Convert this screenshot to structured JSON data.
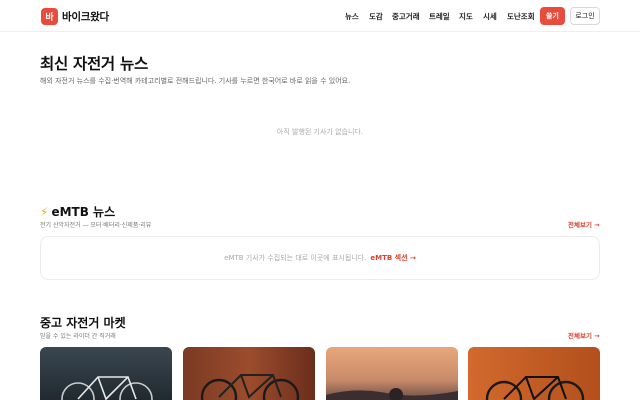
{
  "header": {
    "logo_char": "바",
    "brand": "바이크왔다",
    "nav": [
      "뉴스",
      "도감",
      "중고거래",
      "트레일",
      "지도",
      "시세",
      "도난조회"
    ],
    "write_label": "쓸기",
    "login_label": "로그인"
  },
  "hero": {
    "title": "최신 자전거 뉴스",
    "description": "해외 자전거 뉴스를 수집·번역해 카테고리별로 전해드립니다. 기사를 누르면 한국어로 바로 읽을 수 있어요.",
    "empty": "아직 발행된 기사가 없습니다."
  },
  "emtb": {
    "icon": "⚡",
    "title": "eMTB 뉴스",
    "subtitle": "전기 산악자전거 — 모터·배터리·신제품·리뷰",
    "view_all": "전체보기 →",
    "empty_text": "eMTB 기사가 수집되는 대로 이곳에 표시됩니다.",
    "section_link": "eMTB 섹션 →"
  },
  "market": {
    "title": "중고 자전거 마켓",
    "subtitle": "믿을 수 있는 라이더 간 직거래",
    "view_all": "전체보기 →"
  },
  "colors": {
    "accent": "#e94b3c",
    "link": "#d8412f"
  }
}
